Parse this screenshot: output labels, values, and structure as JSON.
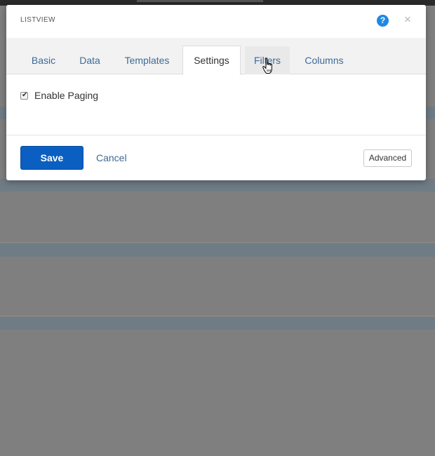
{
  "modal": {
    "title": "LISTVIEW",
    "help_icon": "?",
    "close_icon": "×"
  },
  "tabs": [
    {
      "label": "Basic",
      "state": "normal"
    },
    {
      "label": "Data",
      "state": "normal"
    },
    {
      "label": "Templates",
      "state": "normal"
    },
    {
      "label": "Settings",
      "state": "active"
    },
    {
      "label": "Filters",
      "state": "hover"
    },
    {
      "label": "Columns",
      "state": "normal"
    }
  ],
  "settings": {
    "enable_paging": {
      "label": "Enable Paging",
      "checked": true
    }
  },
  "footer": {
    "save_label": "Save",
    "cancel_label": "Cancel",
    "advanced_label": "Advanced"
  },
  "colors": {
    "accent": "#0b5fc1",
    "link": "#3d6a96",
    "help": "#1e88e5"
  },
  "icons": {
    "help": "help-icon",
    "close": "close-icon",
    "cursor": "hand-pointer-cursor"
  }
}
